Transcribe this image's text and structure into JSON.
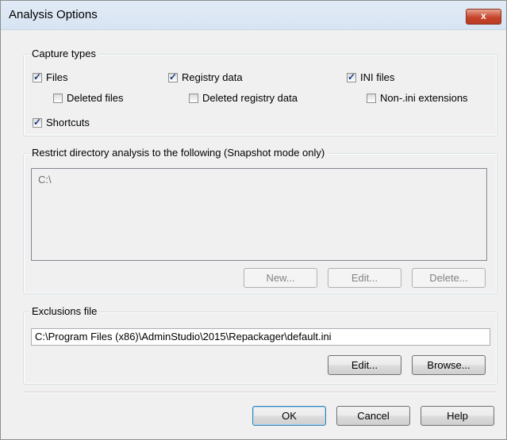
{
  "window": {
    "title": "Analysis Options",
    "close_glyph": "x"
  },
  "capture_types": {
    "legend": "Capture types",
    "options": [
      {
        "label": "Files",
        "checked": true
      },
      {
        "label": "Deleted files",
        "checked": false
      },
      {
        "label": "Registry data",
        "checked": true
      },
      {
        "label": "Deleted registry data",
        "checked": false
      },
      {
        "label": "INI files",
        "checked": true
      },
      {
        "label": "Non-.ini extensions",
        "checked": false
      },
      {
        "label": "Shortcuts",
        "checked": true
      }
    ]
  },
  "restrict": {
    "legend": "Restrict directory analysis to the following (Snapshot mode only)",
    "entries": [
      "C:\\"
    ],
    "buttons": {
      "new": "New...",
      "edit": "Edit...",
      "delete": "Delete..."
    }
  },
  "exclusions": {
    "legend": "Exclusions file",
    "value": "C:\\Program Files (x86)\\AdminStudio\\2015\\Repackager\\default.ini",
    "buttons": {
      "edit": "Edit...",
      "browse": "Browse..."
    }
  },
  "footer": {
    "ok": "OK",
    "cancel": "Cancel",
    "help": "Help"
  }
}
